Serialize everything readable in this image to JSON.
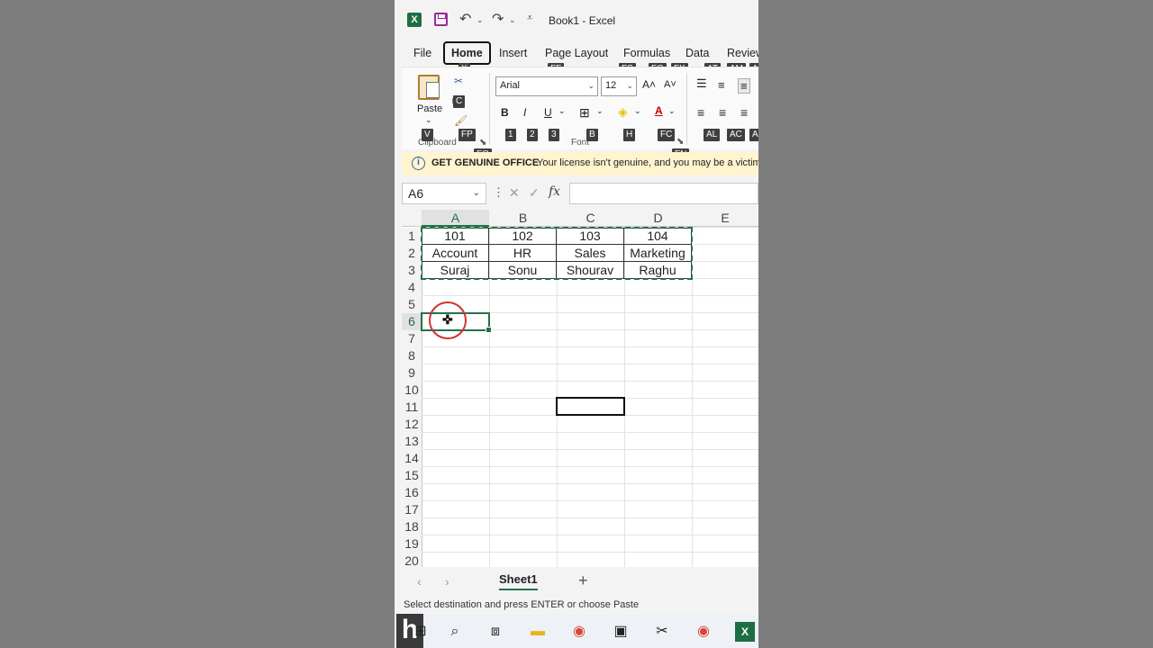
{
  "window": {
    "title": "Book1  -  Excel"
  },
  "tabs": [
    {
      "label": "File"
    },
    {
      "label": "Home"
    },
    {
      "label": "Insert"
    },
    {
      "label": "Page Layout"
    },
    {
      "label": "Formulas"
    },
    {
      "label": "Data"
    },
    {
      "label": "Review"
    }
  ],
  "keytips": {
    "home": "X",
    "page_layout": "FF",
    "formulas1": "FS",
    "formulas2": "FG",
    "formulas3": "FK",
    "data1": "AT",
    "review1": "AM",
    "review2": "A",
    "copy": "C",
    "paste": "V",
    "format_painter": "FP",
    "clipboard_launcher": "FO",
    "bold": "1",
    "italic": "2",
    "underline": "3",
    "border": "B",
    "fill": "H",
    "font_color": "FC",
    "font_launcher": "FN",
    "align_left": "AL",
    "align_center": "AC",
    "align_right": "A"
  },
  "ribbon": {
    "paste_label": "Paste",
    "clipboard_label": "Clipboard",
    "font_label": "Font",
    "font_name": "Arial",
    "font_size": "12",
    "bold": "B",
    "italic": "I",
    "underline": "U",
    "grow_font": "A^",
    "shrink_font": "Aˇ"
  },
  "genuine_bar": {
    "title": "GET GENUINE OFFICE",
    "message": "Your license isn't genuine, and you may be a victim"
  },
  "formula_bar": {
    "name_box": "A6",
    "fx": "fx",
    "value": ""
  },
  "columns": [
    "A",
    "B",
    "C",
    "D",
    "E"
  ],
  "rows": [
    "1",
    "2",
    "3",
    "4",
    "5",
    "6",
    "7",
    "8",
    "9",
    "10",
    "11",
    "12",
    "13",
    "14",
    "15",
    "16",
    "17",
    "18",
    "19",
    "20"
  ],
  "cells": {
    "r1": [
      "101",
      "102",
      "103",
      "104"
    ],
    "r2": [
      "Account",
      "HR",
      "Sales",
      "Marketing"
    ],
    "r3": [
      "Suraj",
      "Sonu",
      "Shourav",
      "Raghu"
    ]
  },
  "sheets": {
    "active": "Sheet1",
    "add": "+"
  },
  "status_text": "Select destination and press ENTER or choose Paste",
  "colors": {
    "excel_green": "#217346",
    "marquee": "#217346",
    "highlight_circle": "#d32f2f"
  }
}
